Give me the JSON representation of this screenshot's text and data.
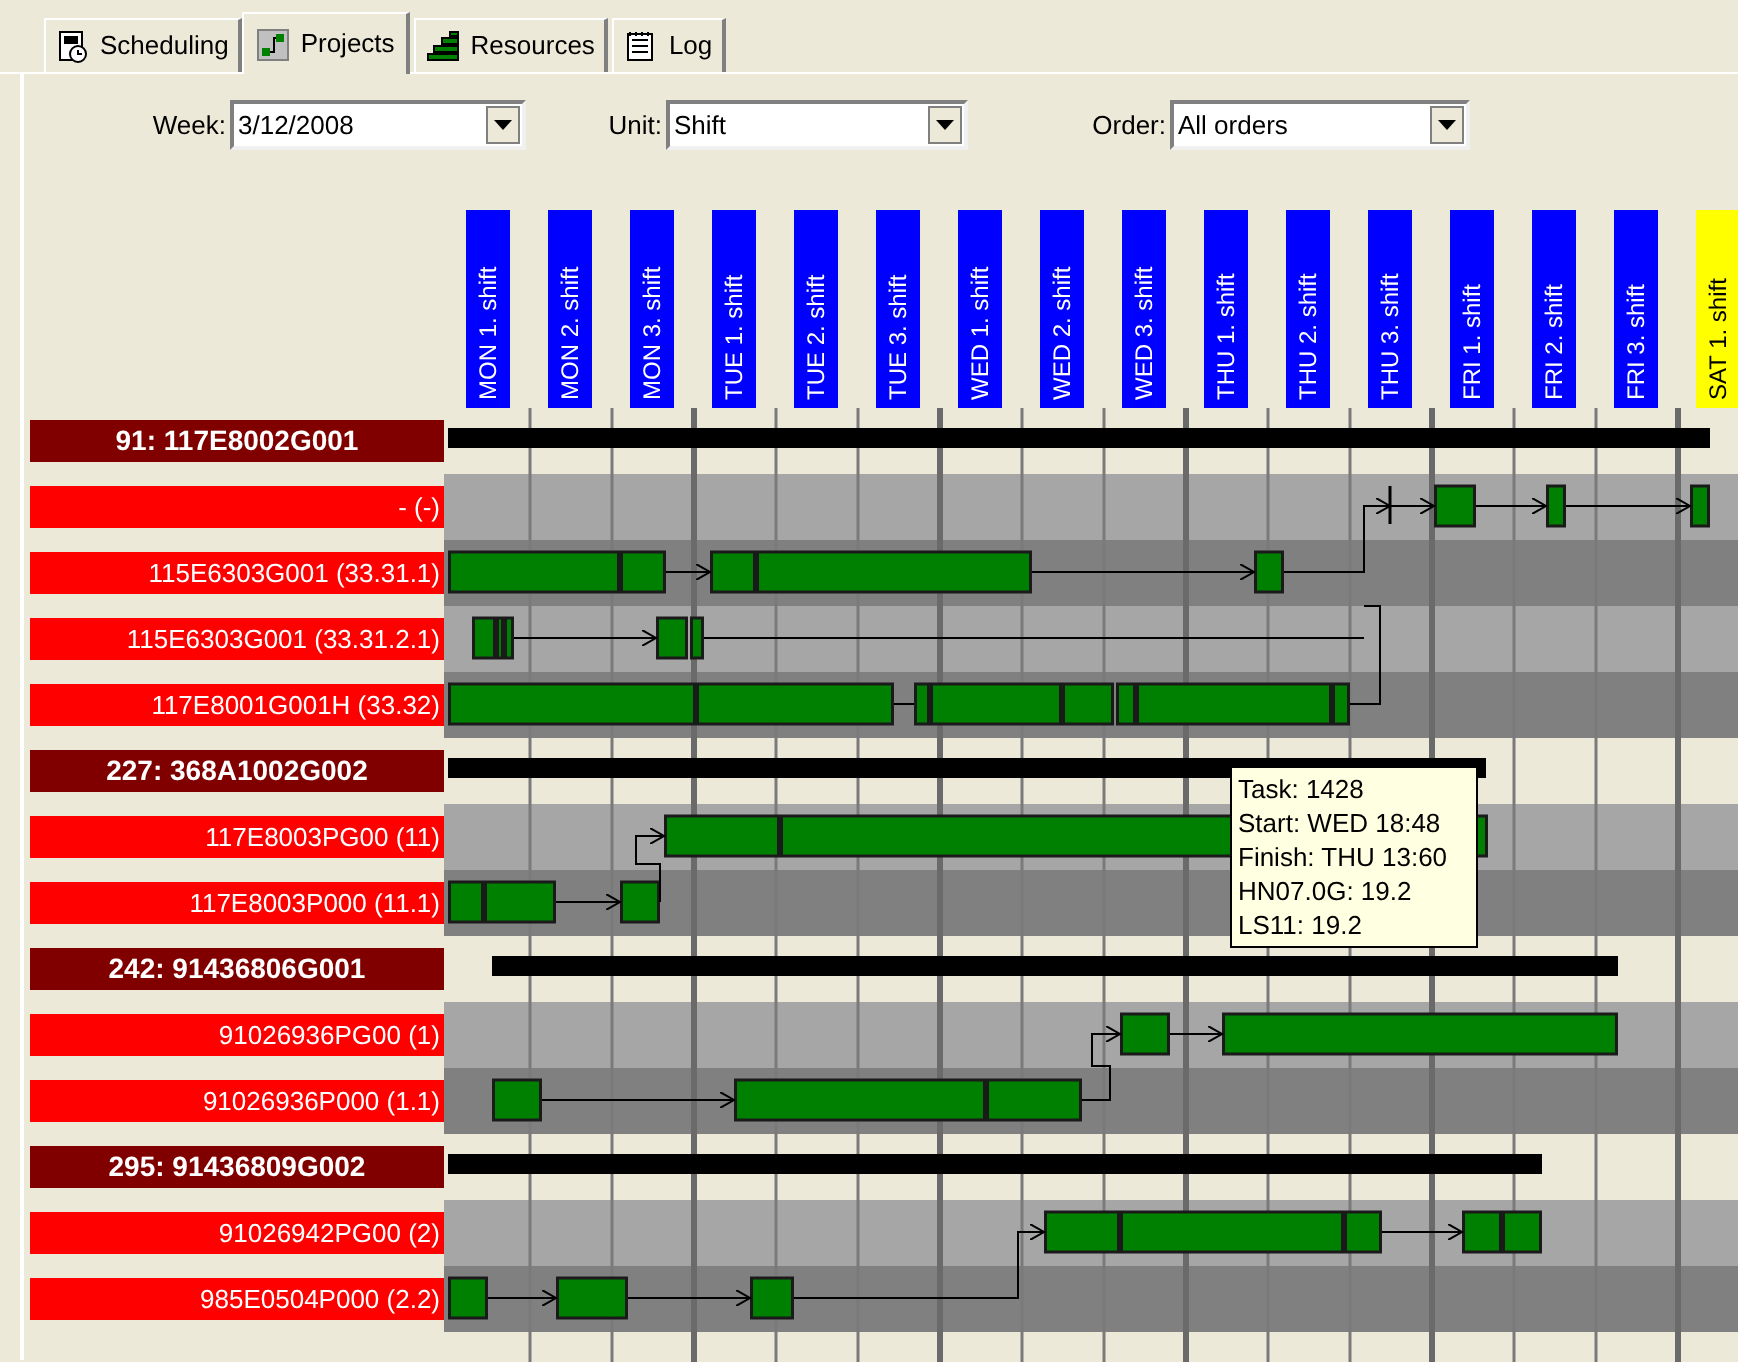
{
  "tabs": [
    {
      "label": "Scheduling",
      "selected": false,
      "kind": "scheduling"
    },
    {
      "label": "Projects",
      "selected": true,
      "kind": "projects"
    },
    {
      "label": "Resources",
      "selected": false,
      "kind": "resources"
    },
    {
      "label": "Log",
      "selected": false,
      "kind": "log"
    }
  ],
  "filters": [
    {
      "label": "Week:",
      "value": "3/12/2008"
    },
    {
      "label": "Unit:",
      "value": "Shift"
    },
    {
      "label": "Order:",
      "value": "All orders"
    }
  ],
  "columns": [
    {
      "label": "MON 1. shift",
      "kind": "weekday"
    },
    {
      "label": "MON 2. shift",
      "kind": "weekday"
    },
    {
      "label": "MON 3. shift",
      "kind": "weekday"
    },
    {
      "label": "TUE 1. shift",
      "kind": "weekday"
    },
    {
      "label": "TUE 2. shift",
      "kind": "weekday"
    },
    {
      "label": "TUE 3. shift",
      "kind": "weekday"
    },
    {
      "label": "WED 1. shift",
      "kind": "weekday"
    },
    {
      "label": "WED 2. shift",
      "kind": "weekday"
    },
    {
      "label": "WED 3. shift",
      "kind": "weekday"
    },
    {
      "label": "THU 1. shift",
      "kind": "weekday"
    },
    {
      "label": "THU 2. shift",
      "kind": "weekday"
    },
    {
      "label": "THU 3. shift",
      "kind": "weekday"
    },
    {
      "label": "FRI 1. shift",
      "kind": "weekday"
    },
    {
      "label": "FRI 2. shift",
      "kind": "weekday"
    },
    {
      "label": "FRI 3. shift",
      "kind": "weekday"
    },
    {
      "label": "SAT 1. shift",
      "kind": "weekend"
    }
  ],
  "rows": [
    {
      "kind": "order",
      "label": "91: 117E8002G001"
    },
    {
      "kind": "task",
      "label": "- (-)"
    },
    {
      "kind": "task",
      "label": "115E6303G001 (33.31.1)"
    },
    {
      "kind": "task",
      "label": "115E6303G001 (33.31.2.1)"
    },
    {
      "kind": "task",
      "label": "117E8001G001H (33.32)"
    },
    {
      "kind": "order",
      "label": "227: 368A1002G002"
    },
    {
      "kind": "task",
      "label": "117E8003PG00 (11)"
    },
    {
      "kind": "task",
      "label": "117E8003P000 (11.1)"
    },
    {
      "kind": "order",
      "label": "242: 91436806G001"
    },
    {
      "kind": "task",
      "label": "91026936PG00 (1)"
    },
    {
      "kind": "task",
      "label": "91026936P000 (1.1)"
    },
    {
      "kind": "order",
      "label": "295: 91436809G002"
    },
    {
      "kind": "task",
      "label": "91026942PG00 (2)"
    },
    {
      "kind": "task",
      "label": "985E0504P000 (2.2)"
    }
  ],
  "tooltip": {
    "lines": [
      "Task: 1428",
      "Start: WED 18:48",
      "Finish: THU 13:60",
      "HN07.0G: 19.2",
      "LS11: 19.2"
    ]
  }
}
